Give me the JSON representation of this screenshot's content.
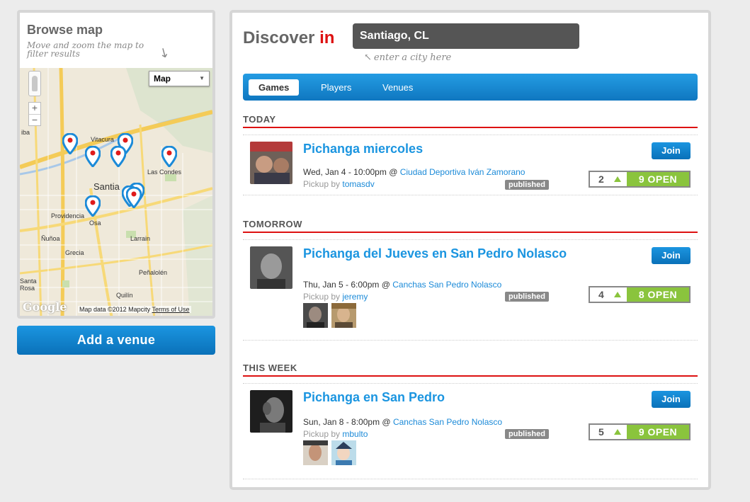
{
  "sidebar": {
    "title": "Browse map",
    "hint": "Move and zoom the map to filter results",
    "map": {
      "type_label": "Map",
      "zoom_in": "+",
      "zoom_out": "−",
      "labels": {
        "vitacura": "Vitacura",
        "las_condes": "Las Condes",
        "santiago": "Santia",
        "providencia": "Providencia",
        "nunoa": "Ñuñoa",
        "osa": "Osa",
        "larrain": "Larrain",
        "grecia": "Grecia",
        "penalolen": "Peñalolén",
        "quilin": "Quilín",
        "santa_rosa": "Santa Rosa",
        "ba": "iba"
      },
      "google": "Google",
      "credit": "Map data ©2012 Mapcity",
      "terms": "Terms of Use"
    },
    "add_venue": "Add a venue"
  },
  "main": {
    "discover": "Discover",
    "in": "in",
    "city_value": "Santiago, CL",
    "city_hint": "enter a city here",
    "tabs": [
      {
        "label": "Games",
        "active": true
      },
      {
        "label": "Players",
        "active": false
      },
      {
        "label": "Venues",
        "active": false
      }
    ],
    "sections": [
      {
        "heading": "TODAY",
        "events": [
          {
            "title": "Pichanga miercoles",
            "when": "Wed, Jan 4 - 10:00pm",
            "at": "@",
            "venue": "Ciudad Deportiva Iván Zamorano",
            "pickup_label": "Pickup by",
            "organizer": "tomasdv",
            "status": "published",
            "join": "Join",
            "count": "2",
            "open": "9 OPEN"
          }
        ]
      },
      {
        "heading": "TOMORROW",
        "events": [
          {
            "title": "Pichanga del Jueves en San Pedro Nolasco",
            "when": "Thu, Jan 5 - 6:00pm",
            "at": "@",
            "venue": "Canchas San Pedro Nolasco",
            "pickup_label": "Pickup by",
            "organizer": "jeremy",
            "status": "published",
            "join": "Join",
            "count": "4",
            "open": "8 OPEN"
          }
        ]
      },
      {
        "heading": "THIS WEEK",
        "events": [
          {
            "title": "Pichanga en San Pedro",
            "when": "Sun, Jan 8 - 8:00pm",
            "at": "@",
            "venue": "Canchas San Pedro Nolasco",
            "pickup_label": "Pickup by",
            "organizer": "mbulto",
            "status": "published",
            "join": "Join",
            "count": "5",
            "open": "9 OPEN"
          }
        ]
      }
    ]
  },
  "colors": {
    "accent_blue": "#1b95e0",
    "discover_red": "#dd1111",
    "open_green": "#8ac43d",
    "badge_gray": "#888888"
  }
}
